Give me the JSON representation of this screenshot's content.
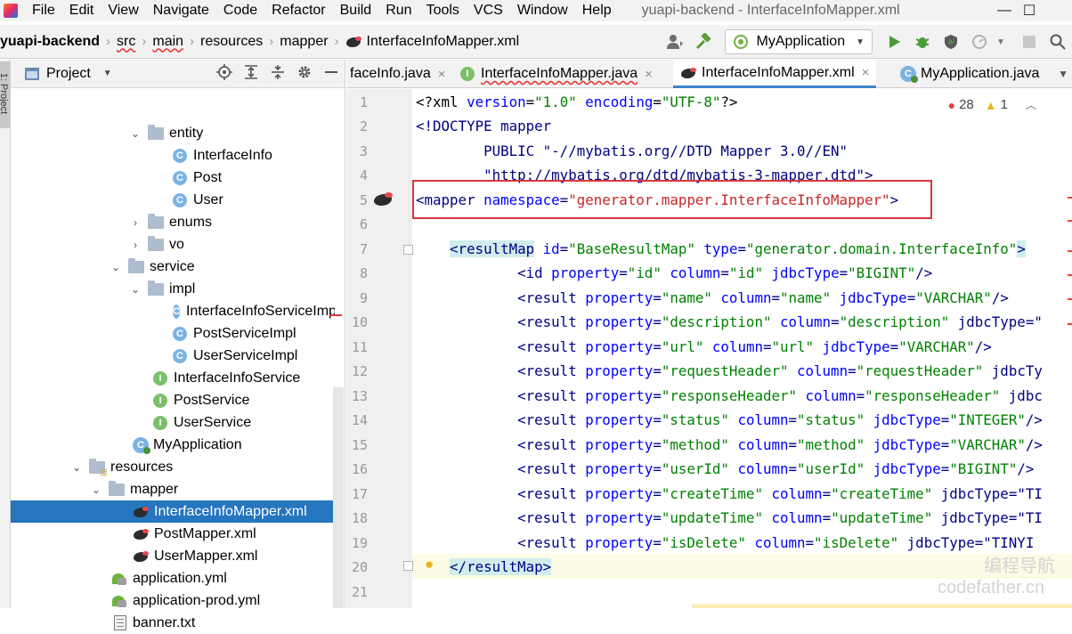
{
  "menubar": {
    "items": [
      {
        "label": "File"
      },
      {
        "label": "Edit"
      },
      {
        "label": "View"
      },
      {
        "label": "Navigate"
      },
      {
        "label": "Code"
      },
      {
        "label": "Refactor"
      },
      {
        "label": "Build"
      },
      {
        "label": "Run"
      },
      {
        "label": "Tools"
      },
      {
        "label": "VCS"
      },
      {
        "label": "Window"
      },
      {
        "label": "Help"
      }
    ],
    "window_title": "yuapi-backend - InterfaceInfoMapper.xml",
    "minimize": "—",
    "maximize": "☐"
  },
  "breadcrumb": {
    "project": "yuapi-backend",
    "parts": [
      "src",
      "main",
      "resources",
      "mapper"
    ],
    "file": "InterfaceInfoMapper.xml",
    "sep": "›"
  },
  "toolbar": {
    "run_config": "MyApplication",
    "icons": [
      "user-icon",
      "hammer-icon",
      "run-icon",
      "debug-icon",
      "coverage-icon",
      "profile-icon",
      "stop-icon",
      "search-icon"
    ]
  },
  "stripe": {
    "label": "1: Project"
  },
  "project_panel": {
    "title": "Project",
    "tree": [
      {
        "label": "entity",
        "type": "folder",
        "expanded": true
      },
      {
        "label": "InterfaceInfo",
        "type": "class"
      },
      {
        "label": "Post",
        "type": "class"
      },
      {
        "label": "User",
        "type": "class"
      },
      {
        "label": "enums",
        "type": "folder",
        "expanded": false
      },
      {
        "label": "vo",
        "type": "folder",
        "expanded": false
      },
      {
        "label": "service",
        "type": "folder",
        "expanded": true
      },
      {
        "label": "impl",
        "type": "folder",
        "expanded": true
      },
      {
        "label": "InterfaceInfoServiceImpl",
        "type": "class"
      },
      {
        "label": "PostServiceImpl",
        "type": "class"
      },
      {
        "label": "UserServiceImpl",
        "type": "class"
      },
      {
        "label": "InterfaceInfoService",
        "type": "interface"
      },
      {
        "label": "PostService",
        "type": "interface"
      },
      {
        "label": "UserService",
        "type": "interface"
      },
      {
        "label": "MyApplication",
        "type": "app"
      },
      {
        "label": "resources",
        "type": "resfolder",
        "expanded": true
      },
      {
        "label": "mapper",
        "type": "folder",
        "expanded": true
      },
      {
        "label": "InterfaceInfoMapper.xml",
        "type": "mybatis",
        "selected": true
      },
      {
        "label": "PostMapper.xml",
        "type": "mybatis"
      },
      {
        "label": "UserMapper.xml",
        "type": "mybatis"
      },
      {
        "label": "application.yml",
        "type": "yml"
      },
      {
        "label": "application-prod.yml",
        "type": "yml"
      },
      {
        "label": "banner.txt",
        "type": "txt"
      }
    ]
  },
  "editor": {
    "tabs": [
      {
        "label": "faceInfo.java",
        "icon": "none"
      },
      {
        "label": "InterfaceInfoMapper.java",
        "icon": "interface"
      },
      {
        "label": "InterfaceInfoMapper.xml",
        "icon": "mybatis",
        "active": true
      },
      {
        "label": "MyApplication.java",
        "icon": "app"
      }
    ],
    "tab_close": "×",
    "inspections": {
      "errors": "28",
      "warnings": "1"
    },
    "line_numbers": [
      "1",
      "2",
      "3",
      "4",
      "5",
      "6",
      "7",
      "8",
      "9",
      "10",
      "11",
      "12",
      "13",
      "14",
      "15",
      "16",
      "17",
      "18",
      "19",
      "20",
      "21"
    ],
    "lines": [
      "<?xml version=\"1.0\" encoding=\"UTF-8\"?>",
      "<!DOCTYPE mapper",
      "        PUBLIC \"-//mybatis.org//DTD Mapper 3.0//EN\"",
      "        \"http://mybatis.org/dtd/mybatis-3-mapper.dtd\">",
      "<mapper namespace=\"generator.mapper.InterfaceInfoMapper\">",
      "",
      "    <resultMap id=\"BaseResultMap\" type=\"generator.domain.InterfaceInfo\">",
      "            <id property=\"id\" column=\"id\" jdbcType=\"BIGINT\"/>",
      "            <result property=\"name\" column=\"name\" jdbcType=\"VARCHAR\"/>",
      "            <result property=\"description\" column=\"description\" jdbcType=\"",
      "            <result property=\"url\" column=\"url\" jdbcType=\"VARCHAR\"/>",
      "            <result property=\"requestHeader\" column=\"requestHeader\" jdbcTy",
      "            <result property=\"responseHeader\" column=\"responseHeader\" jdbc",
      "            <result property=\"status\" column=\"status\" jdbcType=\"INTEGER\"/>",
      "            <result property=\"method\" column=\"method\" jdbcType=\"VARCHAR\"/>",
      "            <result property=\"userId\" column=\"userId\" jdbcType=\"BIGINT\"/>",
      "            <result property=\"createTime\" column=\"createTime\" jdbcType=\"TI",
      "            <result property=\"updateTime\" column=\"updateTime\" jdbcType=\"TI",
      "            <result property=\"isDelete\" column=\"isDelete\" jdbcType=\"TINYI",
      "    </resultMap>",
      ""
    ]
  },
  "watermark": {
    "line1": "编程导航",
    "line2": "codefather.cn"
  },
  "colors": {
    "selection": "#2675bf",
    "highlight_box": "#d9363e",
    "tag": "#000080",
    "attr": "#0000ff",
    "value": "#008000"
  }
}
